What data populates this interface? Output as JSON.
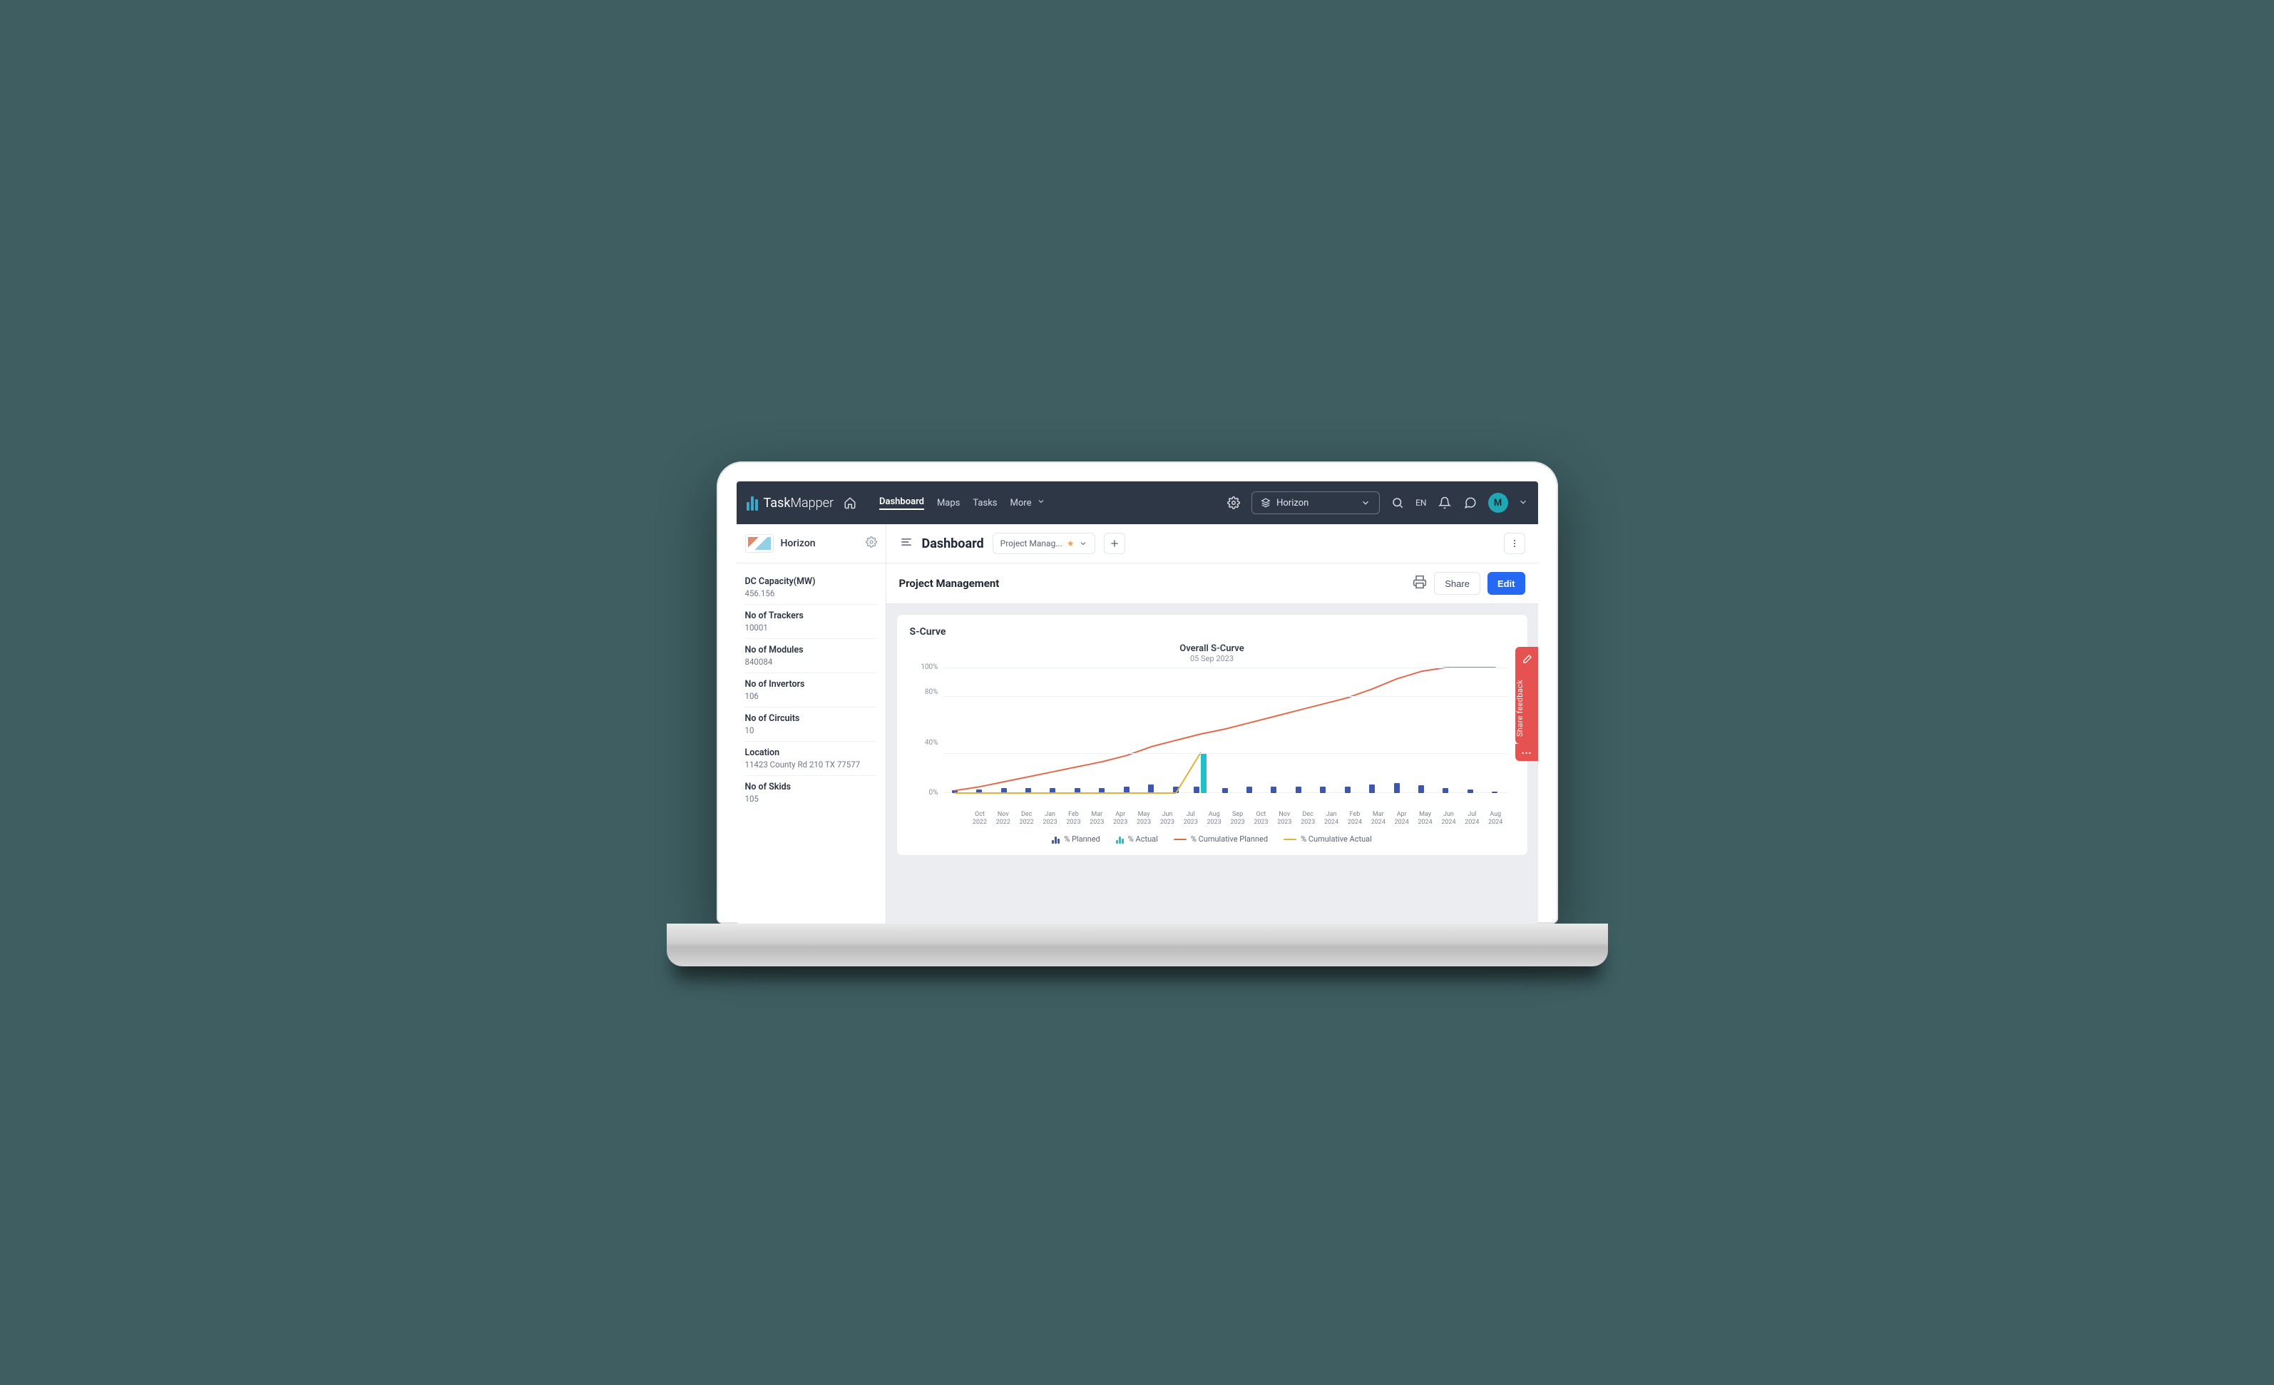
{
  "app": {
    "logo_a": "Task",
    "logo_b": "Mapper"
  },
  "nav": {
    "dashboard": "Dashboard",
    "maps": "Maps",
    "tasks": "Tasks",
    "more": "More"
  },
  "header": {
    "project": "Horizon",
    "lang": "EN",
    "avatar": "M"
  },
  "sidebar": {
    "project_name": "Horizon",
    "metrics": [
      {
        "label": "DC Capacity(MW)",
        "value": "456.156"
      },
      {
        "label": "No of Trackers",
        "value": "10001"
      },
      {
        "label": "No of Modules",
        "value": "840084"
      },
      {
        "label": "No of Invertors",
        "value": "106"
      },
      {
        "label": "No of Circuits",
        "value": "10"
      },
      {
        "label": "Location",
        "value": "11423 County Rd 210  TX 77577"
      },
      {
        "label": "No of Skids",
        "value": "105"
      }
    ]
  },
  "page": {
    "title": "Dashboard",
    "tab_label": "Project Manag...",
    "section_title": "Project Management",
    "share": "Share",
    "edit": "Edit"
  },
  "feedback": {
    "label": "Share feedback"
  },
  "chart_data": {
    "type": "bar",
    "title": "Overall S-Curve",
    "subtitle": "05 Sep 2023",
    "card_title": "S-Curve",
    "ylabel": "",
    "ylim": [
      0,
      100
    ],
    "yticks": [
      "100%",
      "80%",
      "40%",
      "0%"
    ],
    "categories": [
      "Oct 2022",
      "Nov 2022",
      "Dec 2022",
      "Jan 2023",
      "Feb 2023",
      "Mar 2023",
      "Apr 2023",
      "May 2023",
      "Jun 2023",
      "Jul 2023",
      "Aug 2023",
      "Sep 2023",
      "Oct 2023",
      "Nov 2023",
      "Dec 2023",
      "Jan 2024",
      "Feb 2024",
      "Mar 2024",
      "Apr 2024",
      "May 2024",
      "Jun 2024",
      "Jul 2024",
      "Aug 2024"
    ],
    "series": [
      {
        "name": "% Planned",
        "type": "bar",
        "color": "#3d56b0",
        "values": [
          2,
          3,
          4,
          4,
          4,
          4,
          4,
          5,
          7,
          5,
          5,
          4,
          5,
          5,
          5,
          5,
          5,
          7,
          8,
          6,
          4,
          3,
          1
        ]
      },
      {
        "name": "% Actual",
        "type": "bar",
        "color": "#1fc1c9",
        "values": [
          0,
          0,
          0,
          0,
          0,
          0,
          0,
          0,
          0,
          0,
          32,
          0,
          0,
          0,
          0,
          0,
          0,
          0,
          0,
          0,
          0,
          0,
          0
        ]
      },
      {
        "name": "% Cumulative Planned",
        "type": "line",
        "color": "#e46a4c",
        "values": [
          2,
          5,
          9,
          13,
          17,
          21,
          25,
          30,
          37,
          42,
          47,
          51,
          56,
          61,
          66,
          71,
          76,
          83,
          91,
          97,
          100,
          100,
          100
        ]
      },
      {
        "name": "% Cumulative Actual",
        "type": "line",
        "color": "#e1b23c",
        "values": [
          0,
          0,
          0,
          0,
          0,
          0,
          0,
          0,
          0,
          0,
          32,
          null,
          null,
          null,
          null,
          null,
          null,
          null,
          null,
          null,
          null,
          null,
          null
        ]
      }
    ],
    "legend": [
      "% Planned",
      "% Actual",
      "% Cumulative Planned",
      "% Cumulative Actual"
    ]
  }
}
